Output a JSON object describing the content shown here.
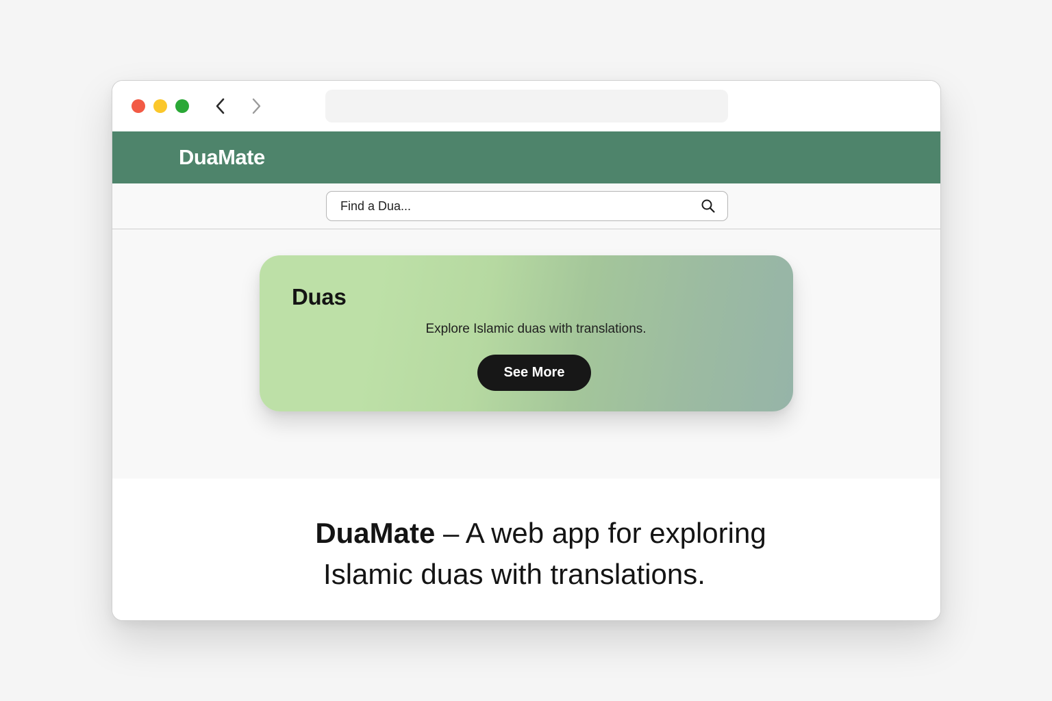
{
  "browser": {
    "address_value": "",
    "icons": {
      "back": "chevron-left-icon",
      "forward": "chevron-right-icon"
    },
    "colors": {
      "close": "#f25a45",
      "minimize": "#fbc72b",
      "maximize": "#2aa836"
    }
  },
  "header": {
    "brand": "DuaMate",
    "color": "#4e846b"
  },
  "search": {
    "placeholder": "Find a Dua...",
    "icon": "search-icon"
  },
  "card": {
    "title": "Duas",
    "description": "Explore Islamic duas with translations.",
    "button_label": "See More",
    "button_color": "#171717"
  },
  "caption": {
    "brand": "DuaMate",
    "line1_rest": " – A web app for exploring",
    "line2": "Islamic duas with translations."
  }
}
